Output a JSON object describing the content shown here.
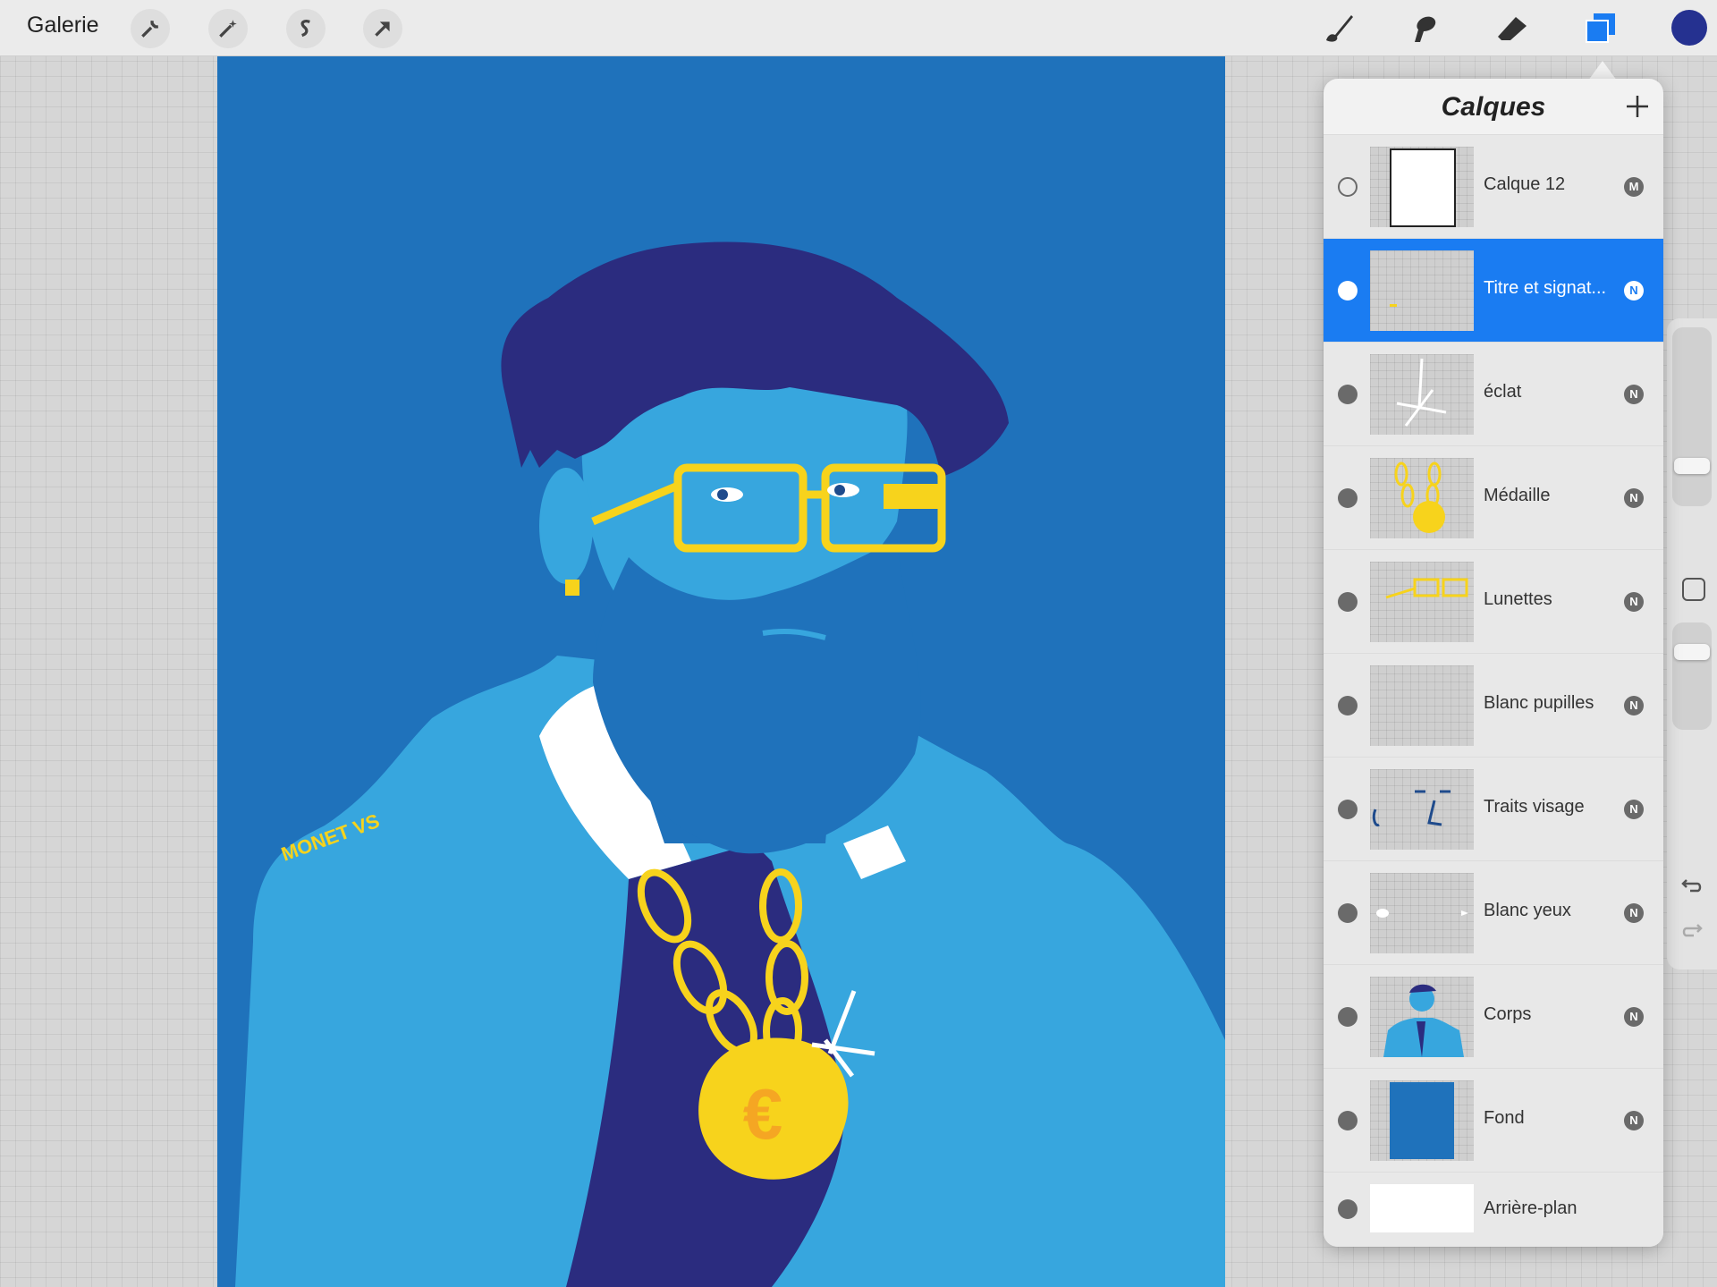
{
  "topbar": {
    "gallery_label": "Galerie",
    "left_tools": [
      "wrench-icon",
      "magic-wand-icon",
      "selection-icon",
      "transform-arrow-icon"
    ],
    "right_tools": [
      "brush-icon",
      "smudge-icon",
      "eraser-icon",
      "layers-icon"
    ],
    "current_color": "#253190"
  },
  "artwork": {
    "signature_text": "MONET VS"
  },
  "layers_panel": {
    "title": "Calques",
    "layers": [
      {
        "name": "Calque 12",
        "mode": "M",
        "visible": false,
        "active": false
      },
      {
        "name": "Titre et signat...",
        "mode": "N",
        "visible": true,
        "active": true
      },
      {
        "name": "éclat",
        "mode": "N",
        "visible": true,
        "active": false
      },
      {
        "name": "Médaille",
        "mode": "N",
        "visible": true,
        "active": false
      },
      {
        "name": "Lunettes",
        "mode": "N",
        "visible": true,
        "active": false
      },
      {
        "name": "Blanc pupilles",
        "mode": "N",
        "visible": true,
        "active": false
      },
      {
        "name": "Traits visage",
        "mode": "N",
        "visible": true,
        "active": false
      },
      {
        "name": "Blanc yeux",
        "mode": "N",
        "visible": true,
        "active": false
      },
      {
        "name": "Corps",
        "mode": "N",
        "visible": true,
        "active": false
      },
      {
        "name": "Fond",
        "mode": "N",
        "visible": true,
        "active": false
      },
      {
        "name": "Arrière-plan",
        "mode": "",
        "visible": true,
        "active": false
      }
    ]
  },
  "colors": {
    "accent": "#1a7cf2",
    "background_blue": "#1f72bb",
    "body_blue": "#37a6de",
    "navy": "#2b2c7f",
    "gold": "#f7d31c"
  }
}
